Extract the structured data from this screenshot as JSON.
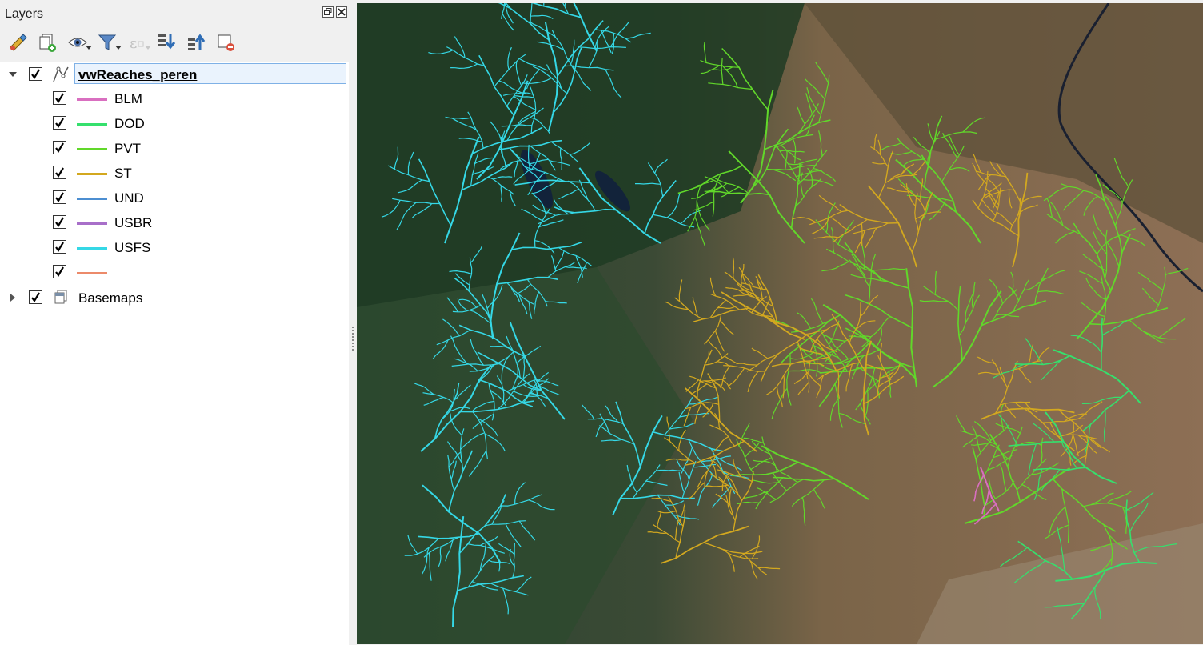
{
  "panel": {
    "title": "Layers"
  },
  "toolbar": [
    {
      "name": "style-manager-icon"
    },
    {
      "name": "add-group-icon"
    },
    {
      "name": "visibility-eye-icon"
    },
    {
      "name": "filter-legend-icon"
    },
    {
      "name": "filter-expression-icon"
    },
    {
      "name": "expand-all-icon"
    },
    {
      "name": "collapse-all-icon"
    },
    {
      "name": "remove-layer-icon"
    }
  ],
  "layers": {
    "main": {
      "name": "vwReaches_peren",
      "checked": true
    },
    "classes": [
      {
        "label": "BLM",
        "color": "#d96fc0",
        "checked": true
      },
      {
        "label": "DOD",
        "color": "#35e06d",
        "checked": true
      },
      {
        "label": "PVT",
        "color": "#61d82a",
        "checked": true
      },
      {
        "label": "ST",
        "color": "#d3a81f",
        "checked": true
      },
      {
        "label": "UND",
        "color": "#4c8ed1",
        "checked": true
      },
      {
        "label": "USBR",
        "color": "#a86fc9",
        "checked": true
      },
      {
        "label": "USFS",
        "color": "#35d8e6",
        "checked": true
      },
      {
        "label": "",
        "color": "#ec8a6a",
        "checked": true
      }
    ],
    "basemaps": {
      "name": "Basemaps",
      "checked": true
    }
  },
  "map": {
    "stream_colors": {
      "usfs": "#35d8e6",
      "pvt": "#61d82a",
      "dod": "#35e06d",
      "st": "#d3a81f",
      "blm": "#d96fc0"
    },
    "terrain_colors": {
      "forest": "#1f3b23",
      "brown": "#8b6d50",
      "river": "#1a2030"
    }
  }
}
